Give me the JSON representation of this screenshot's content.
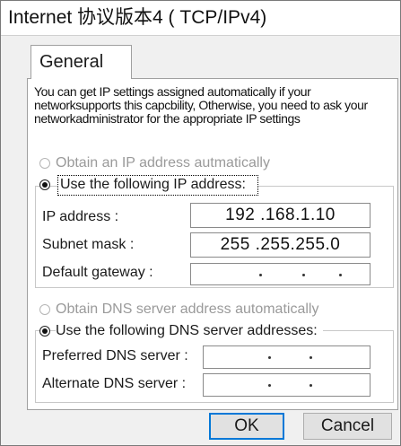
{
  "window": {
    "title": "Internet 协议版本4 ( TCP/IPv4)"
  },
  "tabs": [
    {
      "label": "General",
      "active": true
    }
  ],
  "description": "You can get IP settings assigned automatically if your networksupports this capcbility, Otherwise, you need to ask your networkadministrator for the appropriate IP settings",
  "ip_section": {
    "auto_label": "Obtain an IP address autmatically",
    "auto_selected": false,
    "manual_label": "Use the following IP address:",
    "manual_selected": true,
    "fields": [
      {
        "label": "IP address :",
        "value": "192 .168.1.10"
      },
      {
        "label": "Subnet mask :",
        "value": "255 .255.255.0"
      },
      {
        "label": "Default gateway :",
        "value": ""
      }
    ]
  },
  "dns_section": {
    "auto_label": "Obtain DNS server address automatically",
    "auto_selected": false,
    "manual_label": "Use the following DNS server addresses:",
    "manual_selected": true,
    "fields": [
      {
        "label": "Preferred DNS server :",
        "value": ""
      },
      {
        "label": "Alternate DNS server :",
        "value": ""
      }
    ]
  },
  "buttons": {
    "ok": "OK",
    "cancel": "Cancel"
  },
  "colors": {
    "focus_border": "#0078d7",
    "disabled_text": "#9a9a9a",
    "panel_bg": "#ffffff",
    "window_bg": "#f0f0f0"
  }
}
